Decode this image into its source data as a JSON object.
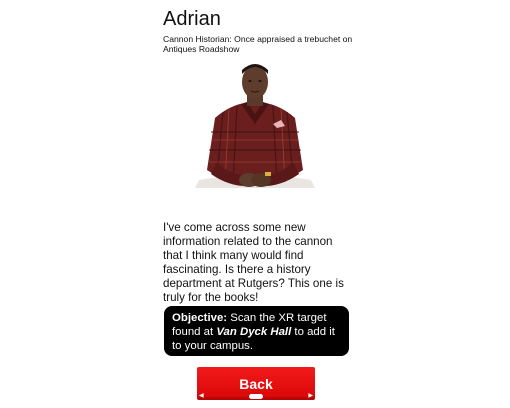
{
  "character": {
    "name": "Adrian",
    "subtitle": "Cannon Historian: Once appraised a trebuchet on Antiques Roadshow"
  },
  "dialogue": {
    "text": "I've come across some new information related to the cannon that I think many would find fascinating. Is there a history department at Rutgers? This one is truly for the books!"
  },
  "objective": {
    "label": "Objective:",
    "text_before": " Scan the XR target found at ",
    "location": "Van Dyck Hall",
    "text_after": " to add it to your campus."
  },
  "back_button": {
    "label": "Back"
  },
  "colors": {
    "accent_red": "#e40d0d",
    "objective_bg": "#000000",
    "shirt": "#6a1f1f"
  },
  "icons": {
    "portrait": "person-portrait-illustration"
  }
}
